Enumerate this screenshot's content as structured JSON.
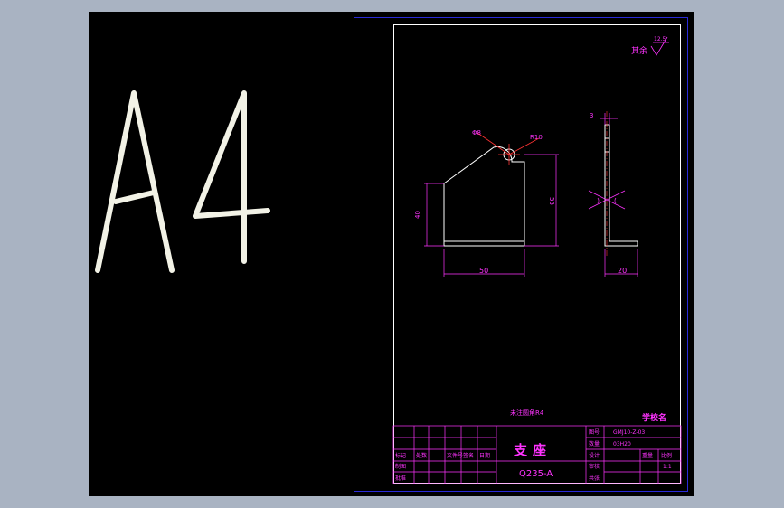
{
  "big_label": "A4",
  "roughness": {
    "label": "其余",
    "value": "12.5"
  },
  "part_view": {
    "hole_dia": "Φ8",
    "radius": "R10",
    "height_left": "40",
    "height_right": "55",
    "width_bottom": "50"
  },
  "side_view": {
    "thickness": "3",
    "width_bottom": "20"
  },
  "note": "未注圆角R4",
  "title_block": {
    "school": "学校名",
    "part_name": "支座",
    "material": "Q235-A",
    "drawing_no_label": "图号",
    "drawing_no": "GMJ10-Z-03",
    "qty_label": "数量",
    "qty": "03H20",
    "scale_label": "比例",
    "scale_value": "1:1",
    "weight_label": "重量",
    "sheet_label": "共张",
    "designer_label": "设计",
    "checker_label": "审核",
    "drawer_label": "制图",
    "approver_label": "批准",
    "header_cols": [
      "标记",
      "处数",
      "文件号",
      "签名",
      "日期"
    ]
  }
}
